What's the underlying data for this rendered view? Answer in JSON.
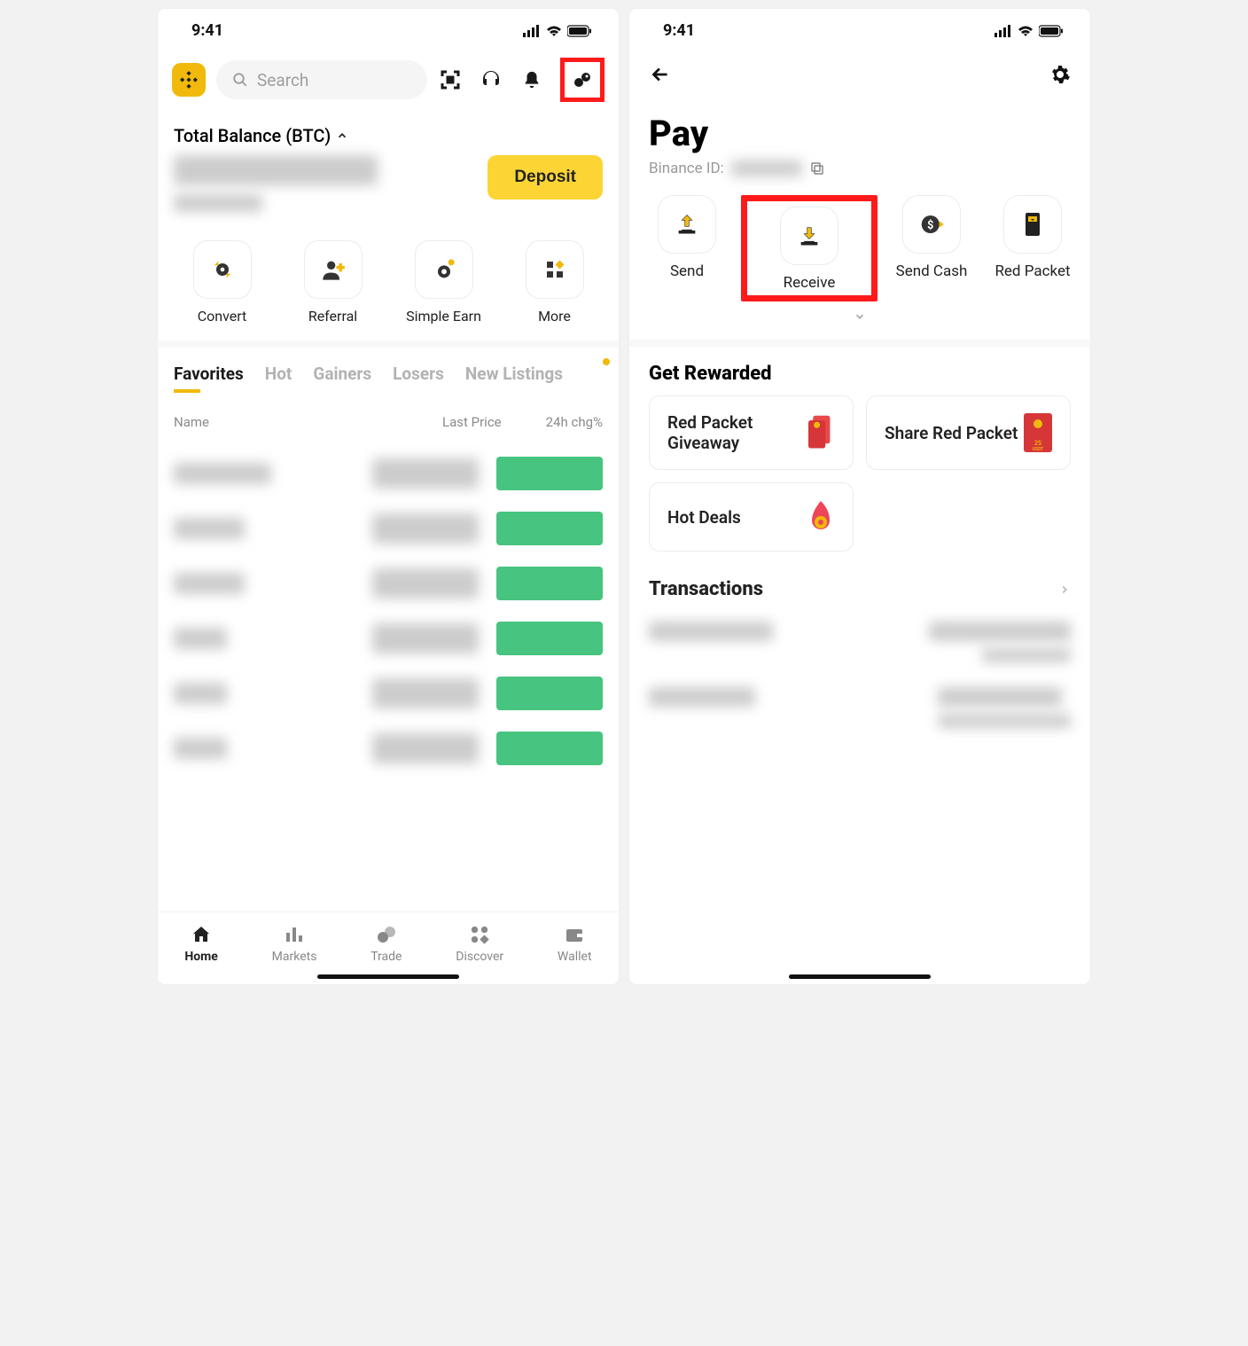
{
  "status": {
    "time": "9:41"
  },
  "left": {
    "search_placeholder": "Search",
    "balance_label": "Total Balance (BTC)",
    "deposit_label": "Deposit",
    "quick_actions": [
      {
        "label": "Convert"
      },
      {
        "label": "Referral"
      },
      {
        "label": "Simple Earn"
      },
      {
        "label": "More"
      }
    ],
    "tabs": [
      "Favorites",
      "Hot",
      "Gainers",
      "Losers",
      "New Listings"
    ],
    "list_headers": {
      "name": "Name",
      "price": "Last Price",
      "chg": "24h chg%"
    },
    "nav": [
      "Home",
      "Markets",
      "Trade",
      "Discover",
      "Wallet"
    ]
  },
  "right": {
    "title": "Pay",
    "sub_label": "Binance ID:",
    "actions": [
      "Send",
      "Receive",
      "Send Cash",
      "Red Packet"
    ],
    "rewarded_title": "Get Rewarded",
    "rewards": [
      "Red Packet Giveaway",
      "Share Red Packet",
      "Hot Deals"
    ],
    "transactions_title": "Transactions"
  }
}
